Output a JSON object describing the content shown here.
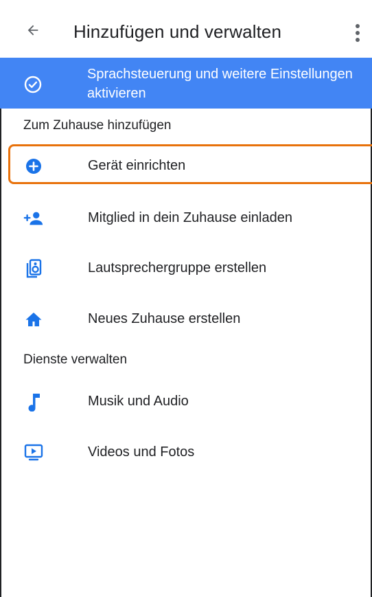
{
  "header": {
    "title": "Hinzufügen und verwalten",
    "back_icon": "arrow-back-icon",
    "menu_icon": "more-vert-icon"
  },
  "banner": {
    "text": "Sprachsteuerung und weitere Einstellungen aktivieren",
    "icon": "check-circle-icon",
    "background": "#4285f4"
  },
  "sections": {
    "add": {
      "title": "Zum Zuhause hinzufügen",
      "items": [
        {
          "label": "Gerät einrichten",
          "icon": "add-circle-icon"
        },
        {
          "label": "Mitglied in dein Zuhause einladen",
          "icon": "add-person-icon"
        },
        {
          "label": "Lautsprechergruppe erstellen",
          "icon": "speaker-group-icon"
        },
        {
          "label": "Neues Zuhause erstellen",
          "icon": "home-icon"
        }
      ]
    },
    "manage": {
      "title": "Dienste verwalten",
      "items": [
        {
          "label": "Musik und Audio",
          "icon": "music-note-icon"
        },
        {
          "label": "Videos und Fotos",
          "icon": "video-play-icon"
        }
      ]
    }
  },
  "colors": {
    "accent": "#4285f4",
    "highlight": "#e8710a",
    "icon": "#1a73e8"
  }
}
